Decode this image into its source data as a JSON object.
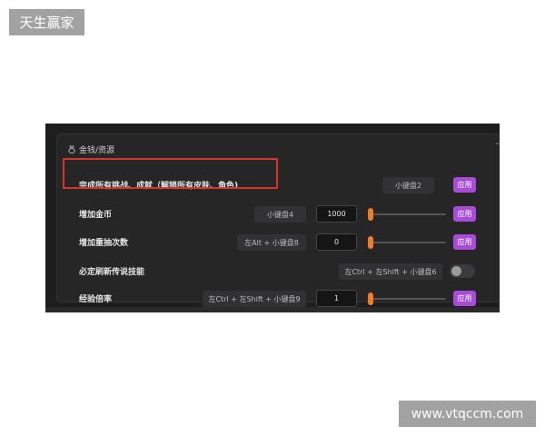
{
  "watermarks": {
    "top_left": "天生赢家",
    "bottom_right": "www.vtqccm.com"
  },
  "panel": {
    "title": "金钱/资源",
    "icon": "coin-icon",
    "collapse_icon": "chevron-up-icon"
  },
  "rows": [
    {
      "label": "完成所有挑战、成就（解锁所有皮肤、角色)",
      "hotkey": "小键盘2",
      "apply_label": "应用",
      "highlighted": true
    },
    {
      "label": "增加金币",
      "hotkey": "小键盘4",
      "value": "1000",
      "slider_level": 0.0,
      "apply_label": "应用"
    },
    {
      "label": "增加重抽次数",
      "hotkey": "左Alt + 小键盘8",
      "value": "0",
      "slider_level": 0.0,
      "apply_label": "应用"
    },
    {
      "label": "必定刷新传说技能",
      "hotkey": "左Ctrl + 左Shift + 小键盘6",
      "toggle_on": false
    },
    {
      "label": "经验倍率",
      "hotkey": "左Ctrl + 左Shift + 小键盘9",
      "value": "1",
      "slider_level": 0.0,
      "apply_label": "应用"
    }
  ],
  "colors": {
    "accent": "#a64cd9",
    "slider_thumb": "#f07c2a",
    "highlight_box": "#d8332f",
    "panel_bg": "#262627"
  }
}
